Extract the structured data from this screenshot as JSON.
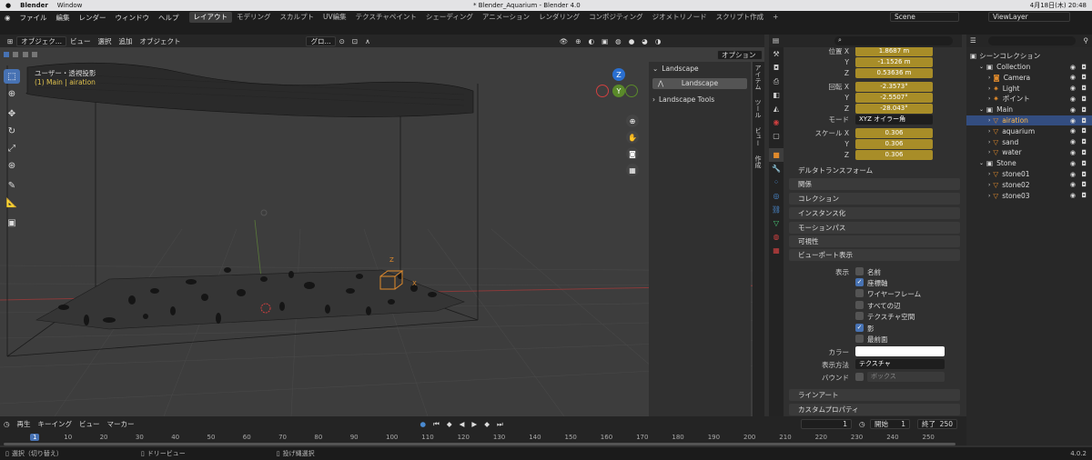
{
  "macbar": {
    "apple": "",
    "app": "Blender",
    "window_menu": "Window",
    "doc_title": "* Blender_Aquarium - Blender 4.0",
    "datetime": "4月18日(木) 20:48"
  },
  "topbar": {
    "menus": [
      "ファイル",
      "編集",
      "レンダー",
      "ウィンドウ",
      "ヘルプ"
    ],
    "workspaces": [
      "レイアウト",
      "モデリング",
      "スカルプト",
      "UV編集",
      "テクスチャペイント",
      "シェーディング",
      "アニメーション",
      "レンダリング",
      "コンポジティング",
      "ジオメトリノード",
      "スクリプト作成"
    ],
    "active_workspace": "レイアウト",
    "add_tab": "+",
    "scene": "Scene",
    "view_layer": "ViewLayer"
  },
  "viewport_header": {
    "mode": "オブジェク...",
    "menus": [
      "ビュー",
      "選択",
      "追加",
      "オブジェクト"
    ],
    "transform": "グロ...",
    "options": "オプション"
  },
  "viewport": {
    "view_name": "ユーザー・透視投影",
    "collection_info": "(1) Main | airation"
  },
  "npanel": {
    "landscape_header": "Landscape",
    "landscape_button": "Landscape",
    "tools_header": "Landscape Tools",
    "tabs": [
      "アイテム",
      "ツール",
      "ビュー",
      "作成"
    ]
  },
  "properties": {
    "location": {
      "x_label": "位置 X",
      "x": "1.8687 m",
      "y_label": "Y",
      "y": "-1.1526 m",
      "z_label": "Z",
      "z": "0.53636 m"
    },
    "rotation": {
      "x_label": "回転 X",
      "x": "-2.3573°",
      "y_label": "Y",
      "y": "-2.5507°",
      "z_label": "Z",
      "z": "-28.043°"
    },
    "mode_label": "モード",
    "mode_value": "XYZ オイラー角",
    "scale": {
      "x_label": "スケール X",
      "x": "0.306",
      "y_label": "Y",
      "y": "0.306",
      "z_label": "Z",
      "z": "0.306"
    },
    "sections": [
      "デルタトランスフォーム",
      "関係",
      "コレクション",
      "インスタンス化",
      "モーションパス",
      "可視性",
      "ビューポート表示"
    ],
    "display_label": "表示",
    "checks": [
      {
        "label": "名前",
        "on": false
      },
      {
        "label": "座標軸",
        "on": true
      },
      {
        "label": "ワイヤーフレーム",
        "on": false
      },
      {
        "label": "すべての辺",
        "on": false
      },
      {
        "label": "テクスチャ空間",
        "on": false
      },
      {
        "label": "影",
        "on": true
      },
      {
        "label": "最前面",
        "on": false
      }
    ],
    "color_label": "カラー",
    "display_as_label": "表示方法",
    "display_as_value": "テクスチャ",
    "bounds_label": "バウンド",
    "bounds_value": "ボックス",
    "bottom_sections": [
      "ラインアート",
      "カスタムプロパティ"
    ]
  },
  "outliner": {
    "title": "シーンコレクション",
    "rows": [
      {
        "label": "Collection",
        "depth": 1,
        "type": "collection"
      },
      {
        "label": "Camera",
        "depth": 2,
        "type": "camera"
      },
      {
        "label": "Light",
        "depth": 2,
        "type": "light"
      },
      {
        "label": "ポイント",
        "depth": 2,
        "type": "light"
      },
      {
        "label": "Main",
        "depth": 1,
        "type": "collection"
      },
      {
        "label": "airation",
        "depth": 2,
        "type": "mesh",
        "selected": true
      },
      {
        "label": "aquarium",
        "depth": 2,
        "type": "mesh"
      },
      {
        "label": "sand",
        "depth": 2,
        "type": "mesh"
      },
      {
        "label": "water",
        "depth": 2,
        "type": "mesh"
      },
      {
        "label": "Stone",
        "depth": 1,
        "type": "collection"
      },
      {
        "label": "stone01",
        "depth": 2,
        "type": "mesh"
      },
      {
        "label": "stone02",
        "depth": 2,
        "type": "mesh"
      },
      {
        "label": "stone03",
        "depth": 2,
        "type": "mesh"
      }
    ]
  },
  "timeline": {
    "menus": [
      "再生",
      "キーイング",
      "ビュー",
      "マーカー"
    ],
    "current_frame": "1",
    "start_label": "開始",
    "start": "1",
    "end_label": "終了",
    "end": "250",
    "ticks": [
      "1",
      "10",
      "20",
      "30",
      "40",
      "50",
      "60",
      "70",
      "80",
      "90",
      "100",
      "110",
      "120",
      "130",
      "140",
      "150",
      "160",
      "170",
      "180",
      "190",
      "200",
      "210",
      "220",
      "230",
      "240",
      "250"
    ]
  },
  "status": {
    "select": "選択（切り替え）",
    "dolly": "ドリービュー",
    "lasso": "投げ縄選択",
    "version": "4.0.2"
  }
}
